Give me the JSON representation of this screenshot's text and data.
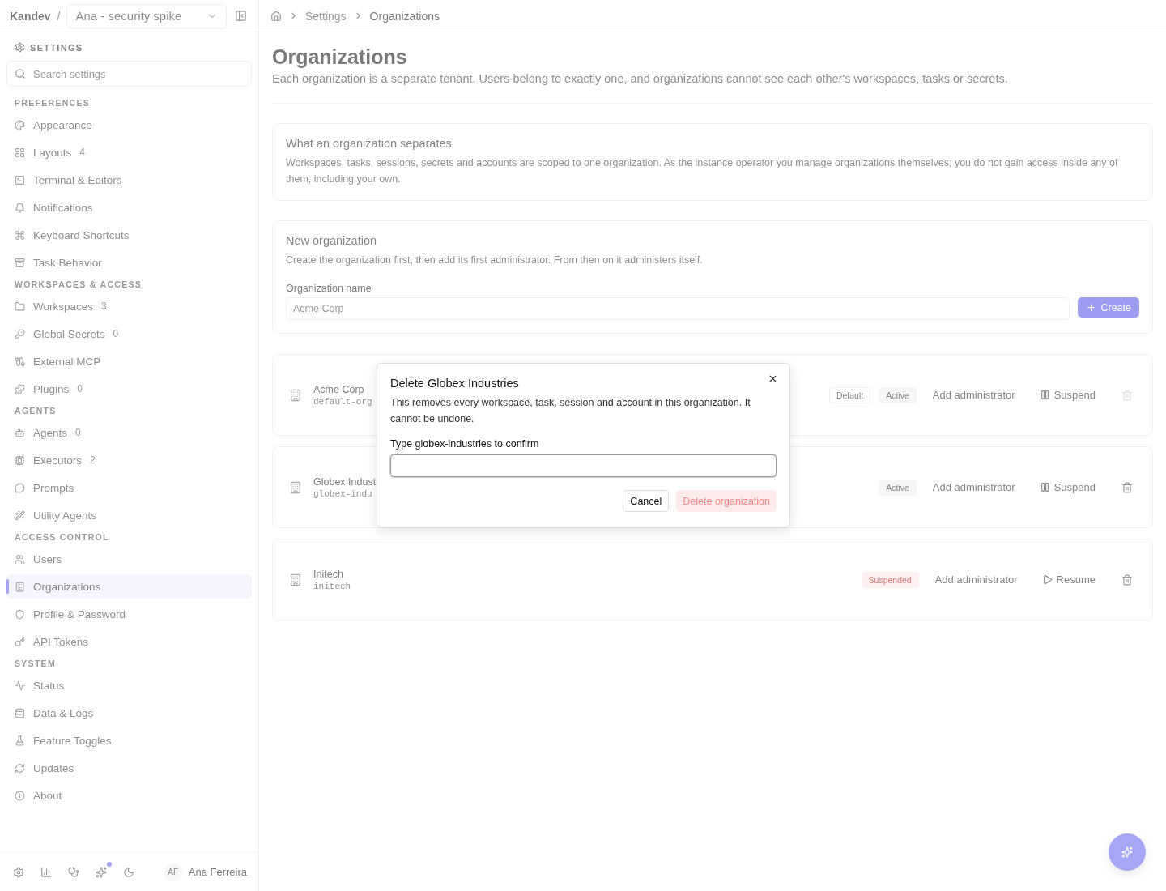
{
  "sidebar": {
    "brand": "Kandev",
    "separator": "/",
    "workspace_select": "Ana - security spike",
    "settings_heading": "SETTINGS",
    "search_placeholder": "Search settings",
    "sections": [
      {
        "title": "PREFERENCES",
        "items": [
          {
            "label": "Appearance",
            "selected": false
          },
          {
            "label": "Layouts",
            "count": "4",
            "selected": false
          },
          {
            "label": "Terminal & Editors",
            "selected": false
          },
          {
            "label": "Notifications",
            "selected": false
          },
          {
            "label": "Keyboard Shortcuts",
            "selected": false
          },
          {
            "label": "Task Behavior",
            "selected": false
          }
        ]
      },
      {
        "title": "WORKSPACES & ACCESS",
        "items": [
          {
            "label": "Workspaces",
            "count": "3",
            "selected": false
          },
          {
            "label": "Global Secrets",
            "count": "0",
            "selected": false
          },
          {
            "label": "External MCP",
            "selected": false
          },
          {
            "label": "Plugins",
            "count": "0",
            "selected": false
          }
        ]
      },
      {
        "title": "AGENTS",
        "items": [
          {
            "label": "Agents",
            "count": "0",
            "selected": false
          },
          {
            "label": "Executors",
            "count": "2",
            "selected": false
          },
          {
            "label": "Prompts",
            "selected": false
          },
          {
            "label": "Utility Agents",
            "selected": false
          }
        ]
      },
      {
        "title": "ACCESS CONTROL",
        "items": [
          {
            "label": "Users",
            "selected": false
          },
          {
            "label": "Organizations",
            "selected": true
          },
          {
            "label": "Profile & Password",
            "selected": false
          },
          {
            "label": "API Tokens",
            "selected": false
          }
        ]
      },
      {
        "title": "SYSTEM",
        "items": [
          {
            "label": "Status",
            "selected": false
          },
          {
            "label": "Data & Logs",
            "selected": false
          },
          {
            "label": "Feature Toggles",
            "selected": false
          },
          {
            "label": "Updates",
            "selected": false
          },
          {
            "label": "About",
            "selected": false
          }
        ]
      }
    ],
    "footer": {
      "user_initials": "AF",
      "user_name": "Ana Ferreira"
    }
  },
  "breadcrumb": [
    "Settings",
    "Organizations"
  ],
  "page": {
    "title": "Organizations",
    "subtitle": "Each organization is a separate tenant. Users belong to exactly one, and organizations cannot see each other's workspaces, tasks or secrets."
  },
  "info_card": {
    "title": "What an organization separates",
    "body": "Workspaces, tasks, sessions, secrets and accounts are scoped to one organization. As the instance operator you manage organizations themselves; you do not gain access inside any of them, including your own."
  },
  "new_organization": {
    "title": "New organization",
    "description": "Create the organization first, then add its first administrator. From then on it administers itself.",
    "field_label": "Organization name",
    "placeholder": "Acme Corp",
    "create_button": "Create"
  },
  "organizations": [
    {
      "name": "Acme Corp",
      "slug": "default-org",
      "badges": [
        {
          "label": "Default",
          "kind": "default"
        },
        {
          "label": "Active",
          "kind": "active"
        }
      ],
      "add_admin": "Add administrator",
      "action": {
        "kind": "suspend",
        "label": "Suspend"
      },
      "delete_disabled": true
    },
    {
      "name": "Globex Indust",
      "slug": "globex-indu",
      "badges": [
        {
          "label": "Active",
          "kind": "active"
        }
      ],
      "add_admin": "Add administrator",
      "action": {
        "kind": "suspend",
        "label": "Suspend"
      },
      "delete_disabled": false
    },
    {
      "name": "Initech",
      "slug": "initech",
      "badges": [
        {
          "label": "Suspended",
          "kind": "suspended"
        }
      ],
      "add_admin": "Add administrator",
      "action": {
        "kind": "resume",
        "label": "Resume"
      },
      "delete_disabled": false
    }
  ],
  "dialog": {
    "title": "Delete Globex Industries",
    "message": "This removes every workspace, task, session and account in this organization. It cannot be undone.",
    "confirm_label": "Type globex-industries to confirm",
    "cancel": "Cancel",
    "delete": {
      "label": "Delete organization",
      "disabled": true
    }
  }
}
